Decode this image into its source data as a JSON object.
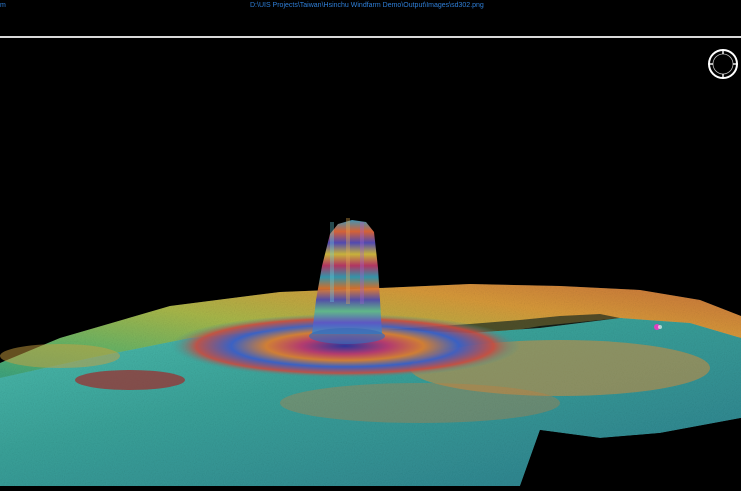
{
  "window": {
    "left_fragment": "m",
    "title_path": "D:\\UIS Projects\\Taiwan\\Hsinchu Windfarm Demo\\Output\\Images\\sd302.png"
  },
  "viewport": {
    "scene": "3d-point-cloud",
    "background": "#000000"
  },
  "compass": {
    "icon": "compass-rose-icon",
    "color": "#ffffff"
  },
  "colors": {
    "title_text": "#2f7fd8",
    "divider": "#d8d8d8"
  }
}
